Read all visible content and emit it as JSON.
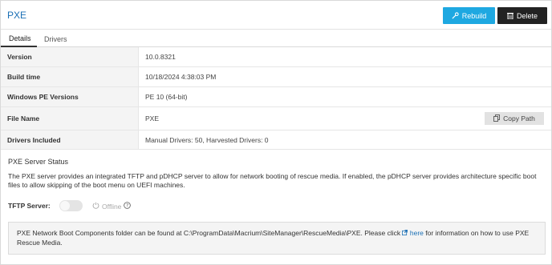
{
  "header": {
    "title": "PXE",
    "rebuild_label": "Rebuild",
    "delete_label": "Delete",
    "rebuild_color": "#1ea8e1",
    "delete_color": "#222222"
  },
  "tabs": [
    {
      "label": "Details",
      "active": true
    },
    {
      "label": "Drivers",
      "active": false
    }
  ],
  "details": [
    {
      "label": "Version",
      "value": "10.0.8321"
    },
    {
      "label": "Build time",
      "value": "10/18/2024 4:38:03 PM"
    },
    {
      "label": "Windows PE Versions",
      "value": "PE 10 (64-bit)"
    },
    {
      "label": "File Name",
      "value": "PXE"
    },
    {
      "label": "Drivers Included",
      "value": "Manual Drivers: 50, Harvested Drivers: 0"
    }
  ],
  "copy_path_label": "Copy Path",
  "pxe_status": {
    "title": "PXE Server Status",
    "description": "The PXE server provides an integrated TFTP and pDHCP server to allow for network booting of rescue media. If enabled, the pDHCP server provides architecture specific boot files to allow skipping of the boot menu on UEFI machines.",
    "tftp_label": "TFTP Server:",
    "tftp_enabled": false,
    "tftp_status": "Offline"
  },
  "info": {
    "text_before": "PXE Network Boot Components folder can be found at C:\\ProgramData\\Macrium\\SiteManager\\RescueMedia\\PXE. Please click ",
    "link_text": "here",
    "text_after": " for information on how to use PXE Rescue Media."
  }
}
